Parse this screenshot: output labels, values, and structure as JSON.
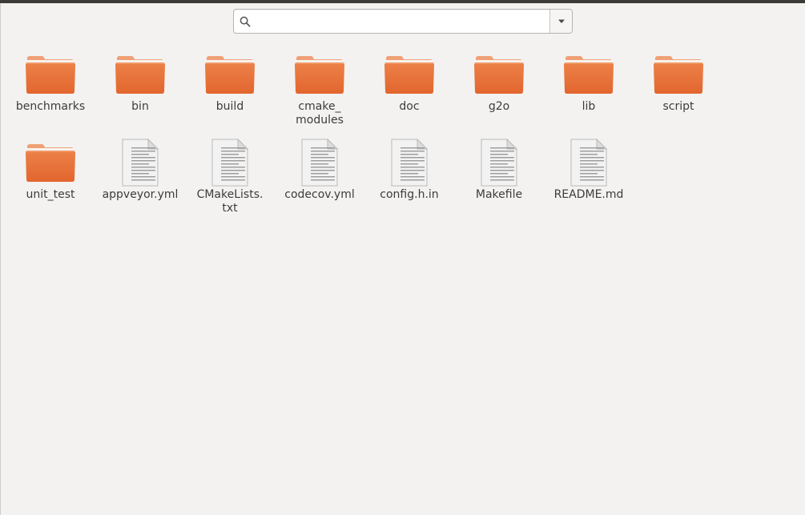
{
  "search": {
    "value": "",
    "placeholder": ""
  },
  "icons": {
    "search": "search-icon",
    "dropdown": "chevron-down-icon",
    "folder": "folder-icon",
    "file": "text-file-icon"
  },
  "colors": {
    "folder_body": "#e2662e",
    "folder_tab": "#f0a075",
    "file_paper": "#f2f2f2",
    "background": "#f3f2f1"
  },
  "items": [
    {
      "label": "benchmarks",
      "type": "folder"
    },
    {
      "label": "bin",
      "type": "folder"
    },
    {
      "label": "build",
      "type": "folder"
    },
    {
      "label": "cmake_\nmodules",
      "type": "folder"
    },
    {
      "label": "doc",
      "type": "folder"
    },
    {
      "label": "g2o",
      "type": "folder"
    },
    {
      "label": "lib",
      "type": "folder"
    },
    {
      "label": "script",
      "type": "folder"
    },
    {
      "label": "unit_test",
      "type": "folder"
    },
    {
      "label": "appveyor.yml",
      "type": "file"
    },
    {
      "label": "CMakeLists.\ntxt",
      "type": "file"
    },
    {
      "label": "codecov.yml",
      "type": "file"
    },
    {
      "label": "config.h.in",
      "type": "file"
    },
    {
      "label": "Makefile",
      "type": "file"
    },
    {
      "label": "README.md",
      "type": "file"
    }
  ]
}
